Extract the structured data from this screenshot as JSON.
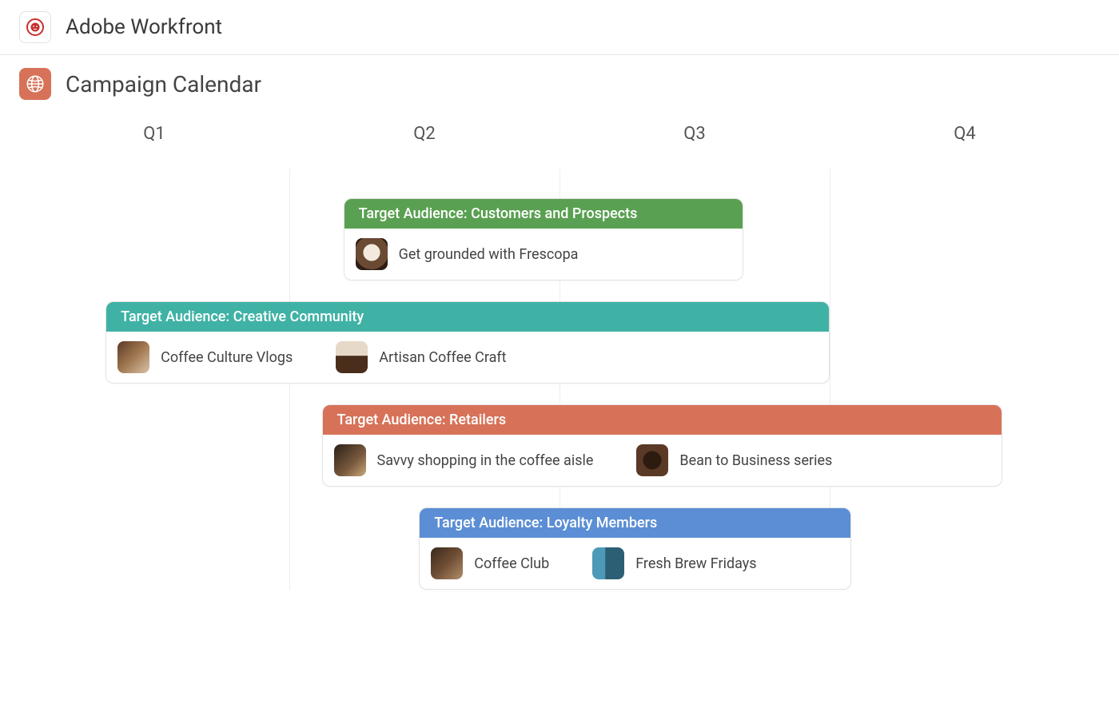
{
  "header": {
    "app_name": "Adobe Workfront",
    "page_title": "Campaign Calendar",
    "brand_icon": "lion-head-icon",
    "page_icon": "globe-icon"
  },
  "quarters": [
    "Q1",
    "Q2",
    "Q3",
    "Q4"
  ],
  "grid_percent": 25,
  "colors": {
    "green": "#5aa052",
    "teal": "#3fb2a5",
    "coral": "#d77258",
    "blue": "#5b8ed4"
  },
  "lanes": [
    {
      "id": "customers-and-prospects",
      "label": "Target Audience: Customers and Prospects",
      "color_key": "green",
      "start_pct": 30,
      "width_pct": 37,
      "items": [
        {
          "id": "frescopa",
          "label": "Get grounded with Frescopa",
          "thumb": "a"
        }
      ]
    },
    {
      "id": "creative-community",
      "label": "Target Audience: Creative Community",
      "color_key": "teal",
      "start_pct": 8,
      "width_pct": 67,
      "items": [
        {
          "id": "coffee-culture-vlogs",
          "label": "Coffee Culture Vlogs",
          "thumb": "b"
        },
        {
          "id": "artisan-coffee-craft",
          "label": "Artisan Coffee Craft",
          "thumb": "c"
        }
      ]
    },
    {
      "id": "retailers",
      "label": "Target Audience: Retailers",
      "color_key": "coral",
      "start_pct": 28,
      "width_pct": 63,
      "items": [
        {
          "id": "savvy-shopping",
          "label": "Savvy shopping in the coffee aisle",
          "thumb": "d"
        },
        {
          "id": "bean-to-business",
          "label": "Bean to Business series",
          "thumb": "e"
        }
      ]
    },
    {
      "id": "loyalty-members",
      "label": "Target Audience: Loyalty Members",
      "color_key": "blue",
      "start_pct": 37,
      "width_pct": 40,
      "items": [
        {
          "id": "coffee-club",
          "label": "Coffee Club",
          "thumb": "f"
        },
        {
          "id": "fresh-brew-fridays",
          "label": "Fresh Brew Fridays",
          "thumb": "g"
        }
      ]
    }
  ]
}
